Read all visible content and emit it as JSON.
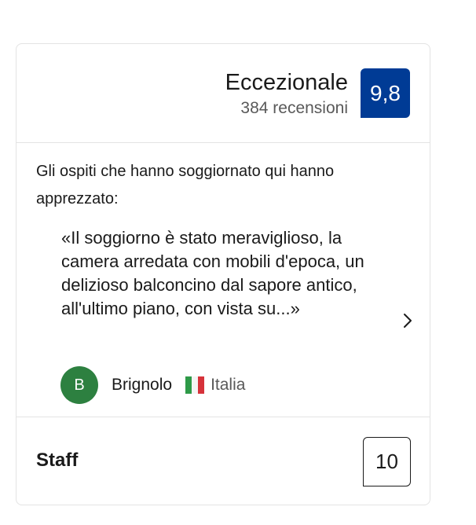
{
  "summary": {
    "rating_word": "Eccezionale",
    "review_count": "384 recensioni",
    "score": "9,8",
    "score_color": "#003b95"
  },
  "highlight": {
    "intro": "Gli ospiti che hanno soggiornato qui hanno apprezzato:",
    "quote": "«Il soggiorno è stato meraviglioso, la camera arredata con mobili d'epoca, un delizioso balconcino dal sapore antico, all'ultimo piano, con vista su...»",
    "next_icon": "chevron-right-icon",
    "reviewer": {
      "initial": "B",
      "name": "Brignolo",
      "country": "Italia",
      "flag_icon": "italy-flag-icon",
      "avatar_color": "#2d8040"
    }
  },
  "category": {
    "label": "Staff",
    "score": "10"
  }
}
